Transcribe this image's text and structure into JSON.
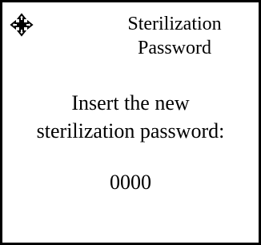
{
  "header": {
    "icon": "navigation-cross-icon",
    "title_line1": "Sterilization",
    "title_line2": "Password"
  },
  "prompt": {
    "line1": "Insert the new",
    "line2": "sterilization password:"
  },
  "password": {
    "value": "0000"
  }
}
